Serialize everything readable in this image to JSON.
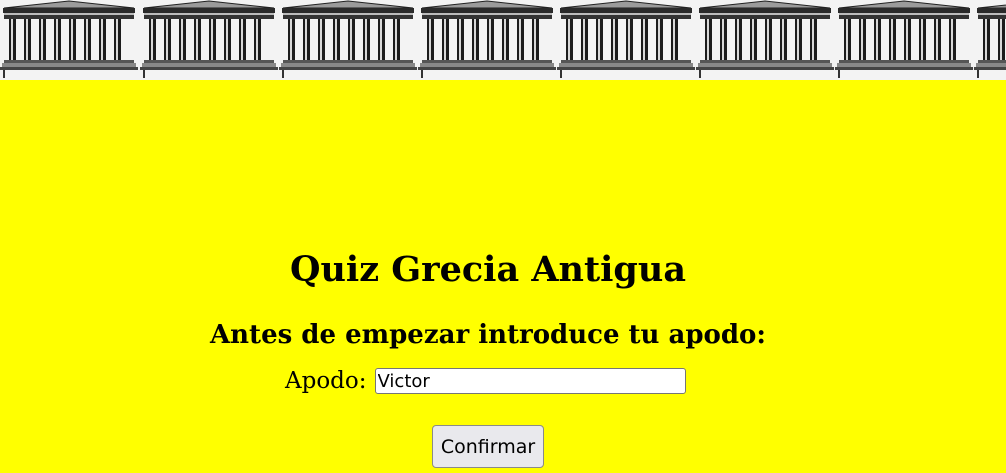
{
  "banner": {
    "icon": "greek-temple-icon",
    "repeat_count": 8
  },
  "page": {
    "title": "Quiz Grecia Antigua",
    "subtitle": "Antes de empezar introduce tu apodo:"
  },
  "form": {
    "nickname_label": "Apodo:",
    "nickname_value": "Victor",
    "confirm_label": "Confirmar"
  },
  "colors": {
    "background": "#ffff00",
    "banner_background": "#f3f3f3",
    "text": "#000000"
  }
}
